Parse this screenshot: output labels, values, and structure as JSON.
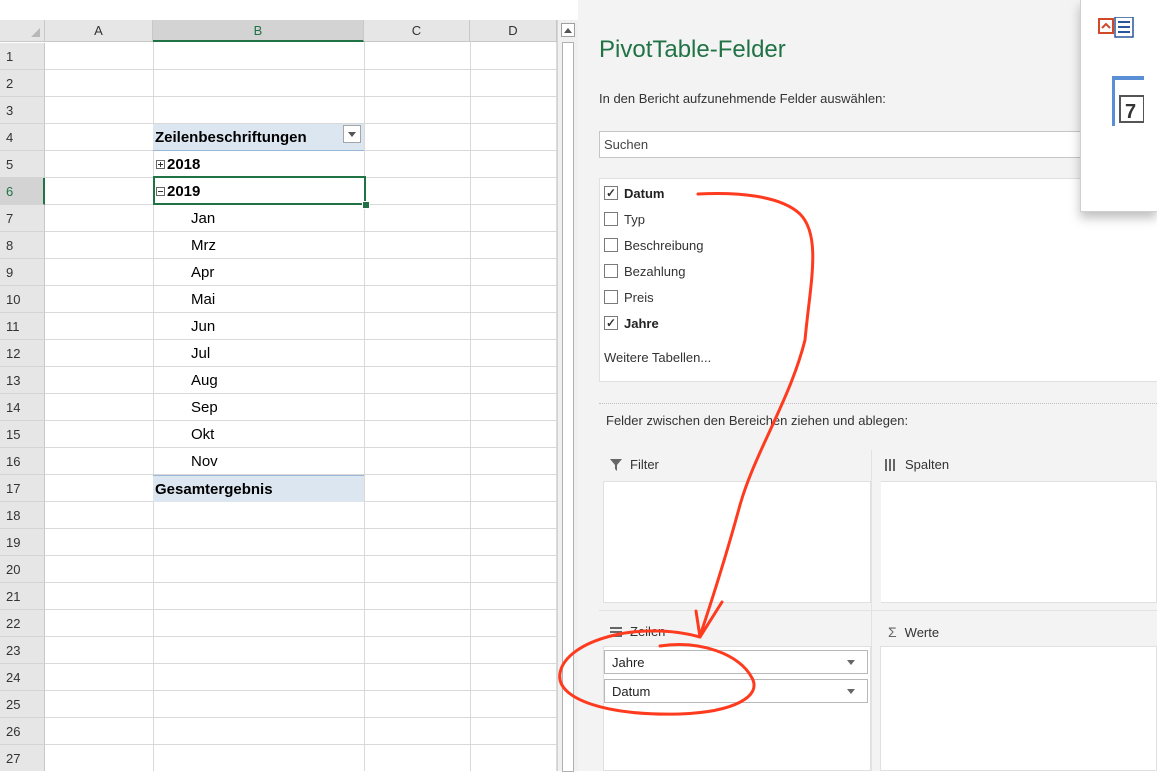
{
  "sheet": {
    "columns": [
      "A",
      "B",
      "C",
      "D"
    ],
    "rows": [
      "1",
      "2",
      "3",
      "4",
      "5",
      "6",
      "7",
      "8",
      "9",
      "10",
      "11",
      "12",
      "13",
      "14",
      "15",
      "16",
      "17",
      "18",
      "19",
      "20",
      "21",
      "22",
      "23",
      "24",
      "25",
      "26",
      "27"
    ],
    "pivot": {
      "header": "Zeilenbeschriftungen",
      "year_2018": "2018",
      "year_2019": "2019",
      "months": [
        "Jan",
        "Mrz",
        "Apr",
        "Mai",
        "Jun",
        "Jul",
        "Aug",
        "Sep",
        "Okt",
        "Nov"
      ],
      "total": "Gesamtergebnis"
    }
  },
  "pane": {
    "title": "PivotTable-Felder",
    "subtitle": "In den Bericht aufzunehmende Felder auswählen:",
    "search_placeholder": "Suchen",
    "fields": [
      {
        "label": "Datum",
        "checked": true
      },
      {
        "label": "Typ",
        "checked": false
      },
      {
        "label": "Beschreibung",
        "checked": false
      },
      {
        "label": "Bezahlung",
        "checked": false
      },
      {
        "label": "Preis",
        "checked": false
      },
      {
        "label": "Jahre",
        "checked": true
      }
    ],
    "more_tables": "Weitere Tabellen...",
    "drag_label": "Felder zwischen den Bereichen ziehen und ablegen:",
    "areas": {
      "filter": "Filter",
      "columns": "Spalten",
      "rows": "Zeilen",
      "values": "Werte"
    },
    "row_fields": [
      "Jahre",
      "Datum"
    ]
  },
  "colors": {
    "accent": "#217346",
    "pivot_header_bg": "#dce6f1",
    "annotation": "#ff3b1f"
  }
}
